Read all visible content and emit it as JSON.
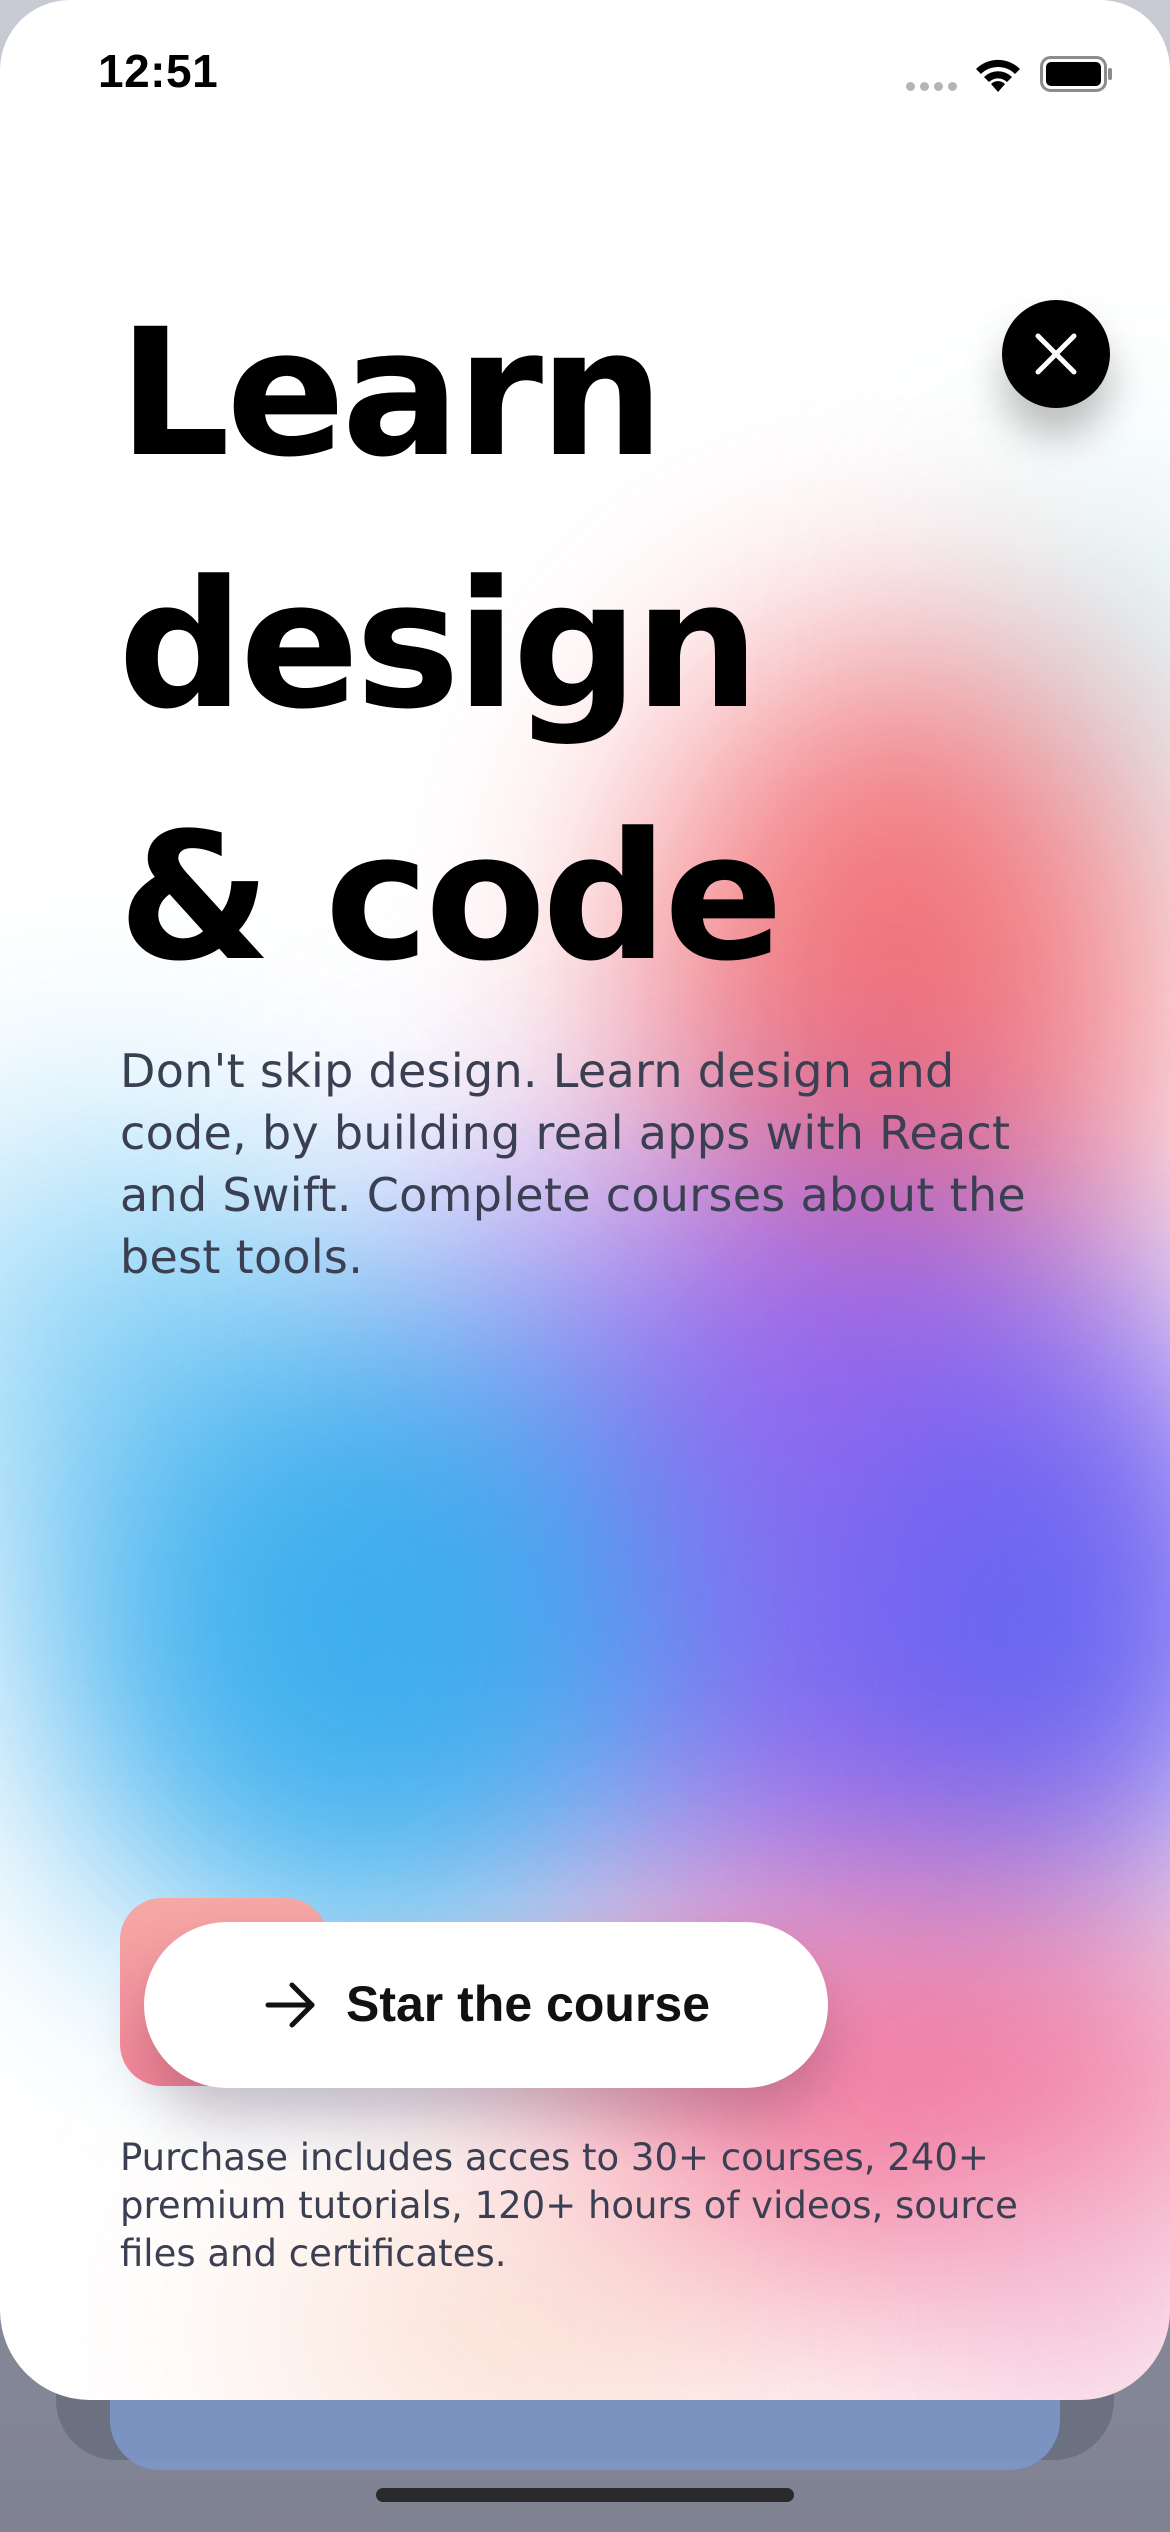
{
  "status_bar": {
    "time": "12:51"
  },
  "icons": {
    "wifi": "wifi-icon",
    "battery": "battery-icon",
    "signal": "cellular-signal-icon",
    "close": "close-icon",
    "arrow": "arrow-right-icon"
  },
  "hero": {
    "headline_line_1": "Learn",
    "headline_line_2": "design",
    "headline_line_3": "& code",
    "description": "Don't skip design. Learn design and code, by building real apps with React and Swift. Complete courses about the best tools."
  },
  "cta": {
    "label": "Star the course"
  },
  "fine_print": "Purchase includes acces to 30+ courses, 240+ premium tutorials, 120+ hours of videos, source files and certificates.",
  "colors": {
    "accent_gradient_start": "#f6a8a5",
    "accent_gradient_end": "#f5879a",
    "headline": "#000000",
    "body_text": "#3b3f52",
    "close_button_bg": "#000000",
    "cta_bg": "#ffffff"
  }
}
